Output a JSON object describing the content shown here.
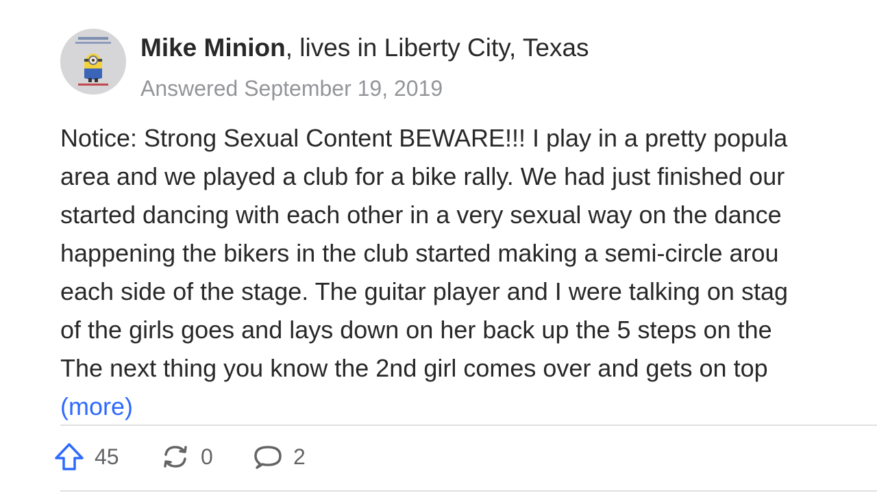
{
  "author": {
    "name": "Mike Minion",
    "credential": ", lives in Liberty City, Texas",
    "avatar_icon": "minion-avatar"
  },
  "answered": "Answered September 19, 2019",
  "body_lines": [
    "Notice: Strong Sexual Content BEWARE!!! I play in a pretty popula",
    "area and we played a club for a bike rally. We had just finished our",
    "started dancing with each other in a very sexual way on the dance",
    "happening the bikers in the club started making a semi-circle arou",
    "each side of the stage. The guitar player and I were talking on stag",
    "of the girls goes and lays down on her back up the 5 steps on the",
    "The next thing you know the 2nd girl comes over and gets on top"
  ],
  "more_label": "(more)",
  "actions": {
    "upvote": {
      "icon": "upvote-arrow-icon",
      "count": "45"
    },
    "share": {
      "icon": "share-icon",
      "count": "0"
    },
    "comment": {
      "icon": "comment-icon",
      "count": "2"
    }
  },
  "colors": {
    "accent": "#2e69ff",
    "text": "#282829",
    "muted": "#939598"
  }
}
